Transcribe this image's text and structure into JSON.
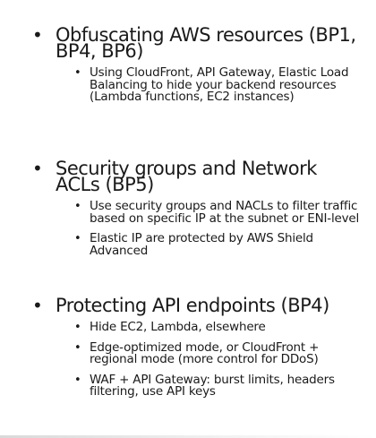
{
  "bullet_char": "•",
  "sections": [
    {
      "heading": "Obfuscating AWS resources (BP1, BP4, BP6)",
      "items": [
        "Using CloudFront, API Gateway, Elastic Load Balancing to hide your backend resources (Lambda functions, EC2 instances)"
      ]
    },
    {
      "heading": "Security groups and Network ACLs (BP5)",
      "items": [
        "Use security groups and NACLs to filter traffic based on specific IP at the subnet or ENI-level",
        "Elastic IP are protected by AWS Shield Advanced"
      ]
    },
    {
      "heading": "Protecting API endpoints (BP4)",
      "items": [
        "Hide EC2, Lambda, elsewhere",
        "Edge-optimized mode, or CloudFront + regional mode (more control for DDoS)",
        "WAF + API Gateway: burst limits, headers filtering, use API keys"
      ]
    }
  ]
}
